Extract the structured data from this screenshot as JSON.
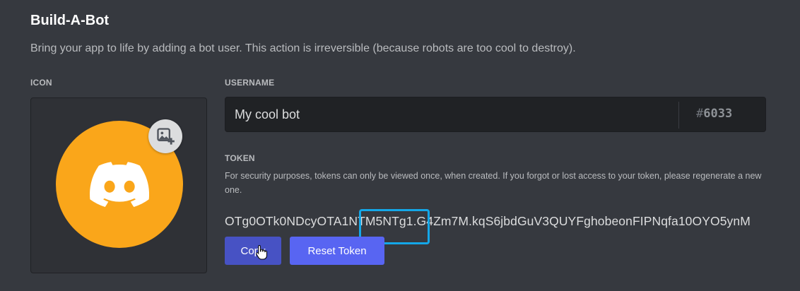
{
  "section": {
    "title": "Build-A-Bot",
    "subtitle": "Bring your app to life by adding a bot user. This action is irreversible (because robots are too cool to destroy)."
  },
  "icon": {
    "label": "ICON",
    "avatar_color": "#faa61a",
    "avatar_glyph": "discord-logo-icon",
    "upload_glyph": "image-add-icon"
  },
  "username": {
    "label": "USERNAME",
    "value": "My cool bot",
    "discriminator_prefix": "#",
    "discriminator": "6033"
  },
  "token": {
    "label": "TOKEN",
    "help": "For security purposes, tokens can only be viewed once, when created. If you forgot or lost access to your token, please regenerate a new one.",
    "value": "OTg0OTk0NDcyOTA1NTM5NTg1.G4Zm7M.kqS6jbdGuV3QUYFghobeonFIPNqfa10OYO5ynM",
    "copy_label": "Copy",
    "reset_label": "Reset Token",
    "highlight_color": "#14a7e8"
  },
  "colors": {
    "background": "#36393f",
    "input_bg": "#202225",
    "blurple": "#5865f2",
    "blurple_dark": "#4752c4"
  }
}
